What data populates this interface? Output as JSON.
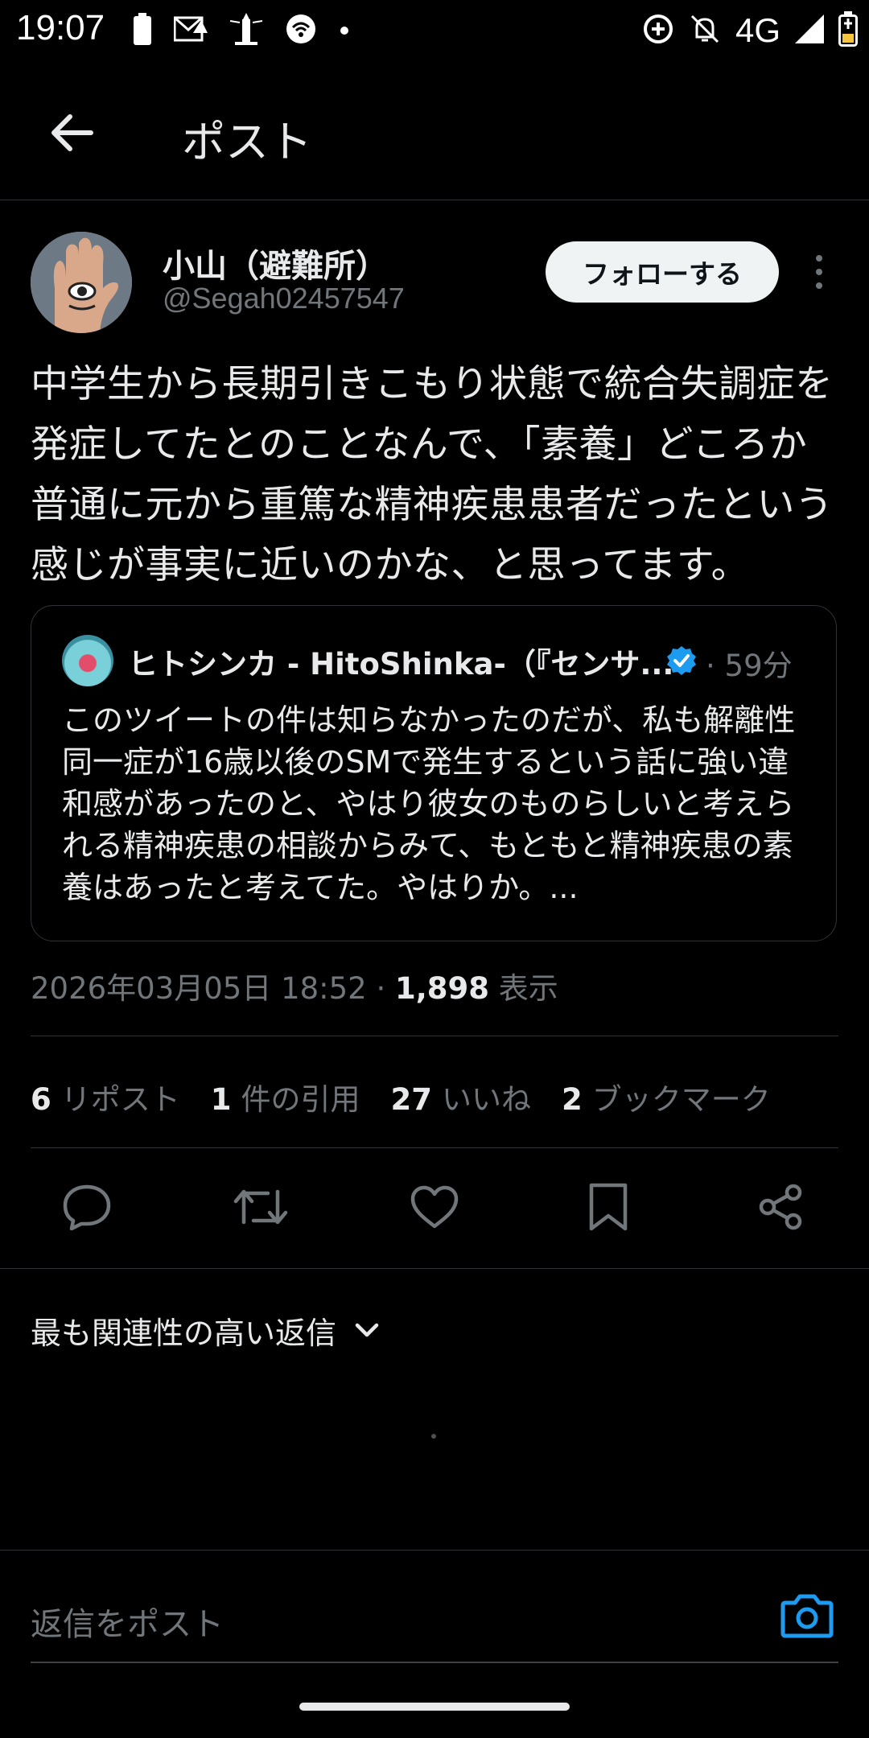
{
  "status_bar": {
    "time": "19:07",
    "network": "4G",
    "icons_left": [
      "battery-icon",
      "mail-alert-icon",
      "lighthouse-icon",
      "hotspot-icon",
      "dot-icon"
    ],
    "icons_right": [
      "data-saver-icon",
      "bell-off-icon",
      "signal-icon",
      "battery-charging-icon"
    ]
  },
  "header": {
    "title": "ポスト"
  },
  "post": {
    "author_name": "小山（避難所）",
    "author_handle": "@Segah02457547",
    "follow_label": "フォローする",
    "text": "中学生から長期引きこもり状態で統合失調症を発症してたとのことなんで、「素養」どころか普通に元から重篤な精神疾患患者だったという感じが事実に近いのかな、と思ってます。",
    "quote": {
      "author_name": "ヒトシンカ - HitoShinka-（『センサ...",
      "time": "· 59分",
      "text": "このツイートの件は知らなかったのだが、私も解離性同一症が16歳以後のSMで発生するという話に強い違和感があったのと、やはり彼女のものらしいと考えられる精神疾患の相談からみて、もともと精神疾患の素養はあったと考えてた。やはりか。..."
    },
    "timestamp": "2026年03月05日 18:52 · ",
    "views_count": "1,898",
    "views_label": " 表示",
    "stats": [
      {
        "count": "6",
        "label": "リポスト"
      },
      {
        "count": "1",
        "label": "件の引用"
      },
      {
        "count": "27",
        "label": "いいね"
      },
      {
        "count": "2",
        "label": "ブックマーク"
      }
    ]
  },
  "replies": {
    "sort_label": "最も関連性の高い返信"
  },
  "reply_composer": {
    "placeholder": "返信をポスト"
  },
  "colors": {
    "background": "#000000",
    "text": "#e7e9ea",
    "muted": "#71767b",
    "accent": "#1d9bf0",
    "divider": "#2f3336"
  }
}
